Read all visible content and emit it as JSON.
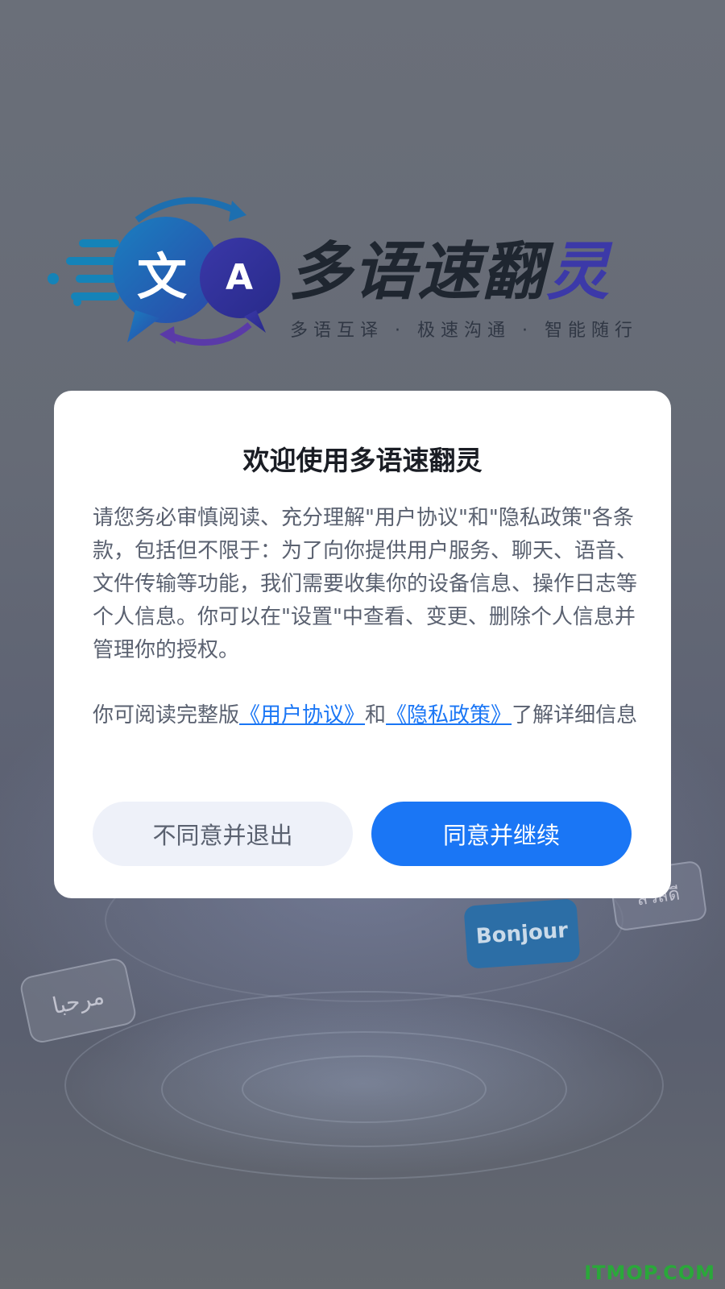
{
  "logo": {
    "badge_left_glyph": "文",
    "badge_right_glyph": "A",
    "title_main": "多语速翻",
    "title_last": "灵",
    "tagline": "多语互译 · 极速沟通 · 智能随行"
  },
  "background": {
    "bubbles": [
      "Bonjour",
      "مرحبا",
      "สวัสดี"
    ]
  },
  "dialog": {
    "title": "欢迎使用多语速翻灵",
    "paragraph1": "请您务必审慎阅读、充分理解\"用户协议\"和\"隐私政策\"各条款，包括但不限于：为了向你提供用户服务、聊天、语音、文件传输等功能，我们需要收集你的设备信息、操作日志等个人信息。你可以在\"设置\"中查看、变更、删除个人信息并管理你的授权。",
    "p2_prefix": "你可阅读完整版",
    "user_agreement_link": "《用户协议》",
    "p2_and": "和",
    "privacy_policy_link": "《隐私政策》",
    "p2_suffix": "了解详细信息",
    "decline_button": "不同意并退出",
    "accept_button": "同意并继续"
  },
  "watermark": "ITMOP.COM",
  "colors": {
    "accent": "#1a76f5",
    "decline_bg": "#eef1f9",
    "text_secondary": "#5a6170",
    "title_text": "#1a1d24"
  }
}
